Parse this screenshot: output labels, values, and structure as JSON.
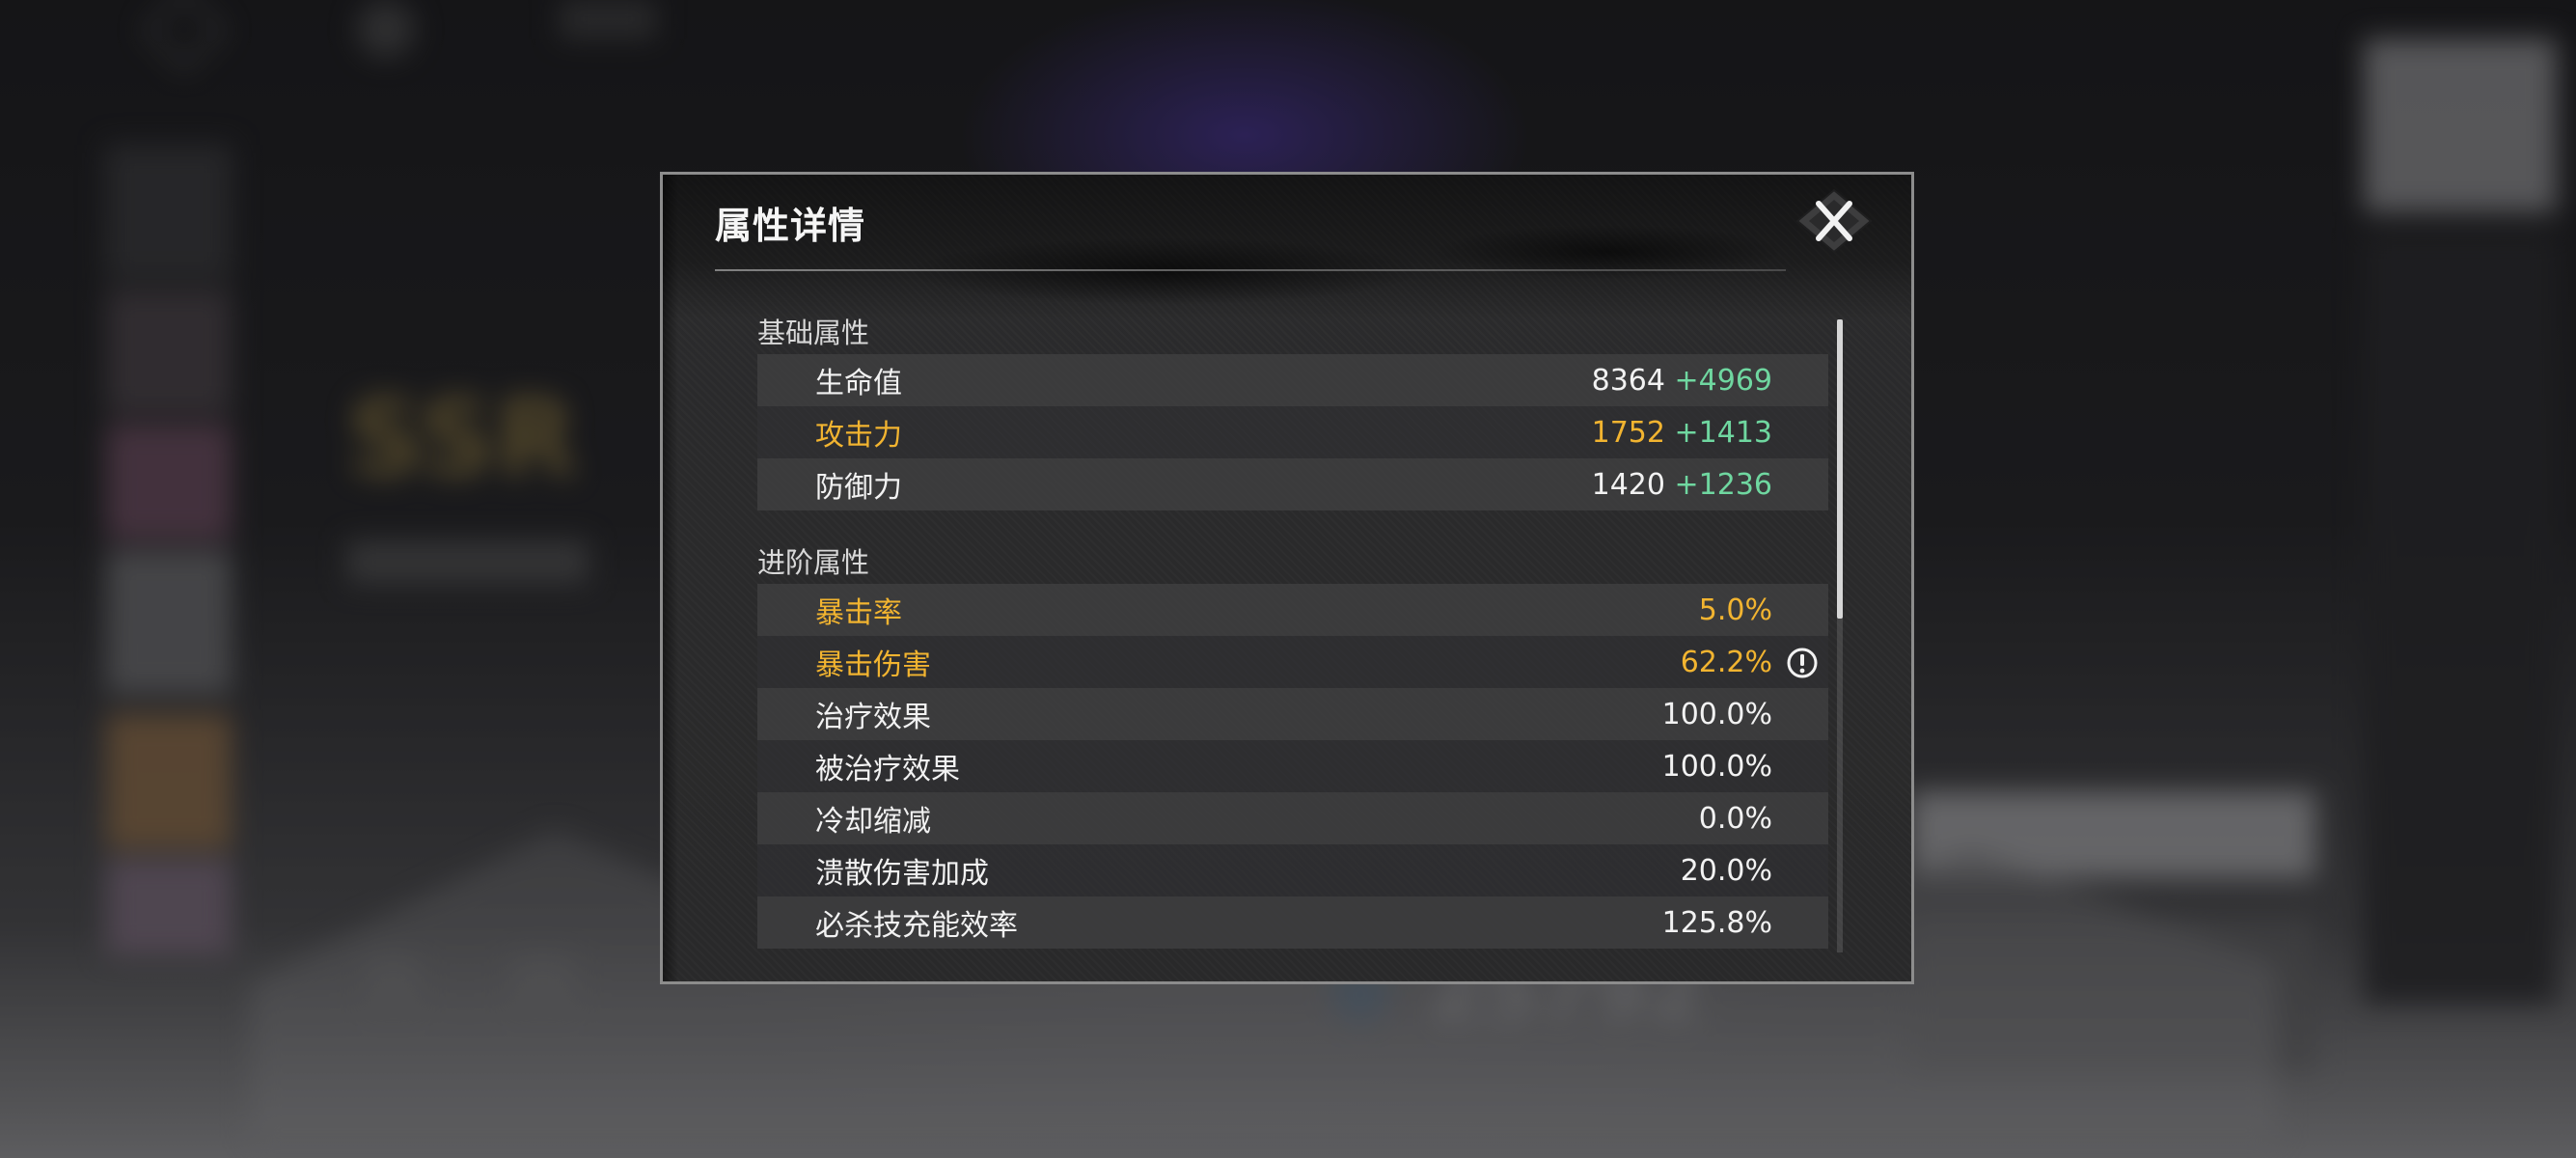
{
  "dialog": {
    "title": "属性详情",
    "close_icon": "close-x-icon"
  },
  "sections": [
    {
      "title": "基础属性",
      "rows": [
        {
          "label": "生命值",
          "base": "8364",
          "bonus": "+4969",
          "highlight": false
        },
        {
          "label": "攻击力",
          "base": "1752",
          "bonus": "+1413",
          "highlight": true
        },
        {
          "label": "防御力",
          "base": "1420",
          "bonus": "+1236",
          "highlight": false
        }
      ]
    },
    {
      "title": "进阶属性",
      "rows": [
        {
          "label": "暴击率",
          "base": "5.0%",
          "highlight": true
        },
        {
          "label": "暴击伤害",
          "base": "62.2%",
          "highlight": true,
          "info_icon": "info-exclamation-icon"
        },
        {
          "label": "治疗效果",
          "base": "100.0%",
          "highlight": false
        },
        {
          "label": "被治疗效果",
          "base": "100.0%",
          "highlight": false
        },
        {
          "label": "冷却缩减",
          "base": "0.0%",
          "highlight": false
        },
        {
          "label": "溃散伤害加成",
          "base": "20.0%",
          "highlight": false
        },
        {
          "label": "必杀技充能效率",
          "base": "125.8%",
          "highlight": false
        }
      ]
    }
  ],
  "colors": {
    "highlight": "#f2b430",
    "bonus": "#6fd7a0",
    "text": "#f2f2f2",
    "dialog_bg": "#2a2a2b",
    "dialog_border": "#8c8c8c"
  },
  "background": {
    "rarity_text": "SSR",
    "power_value": "25792"
  }
}
